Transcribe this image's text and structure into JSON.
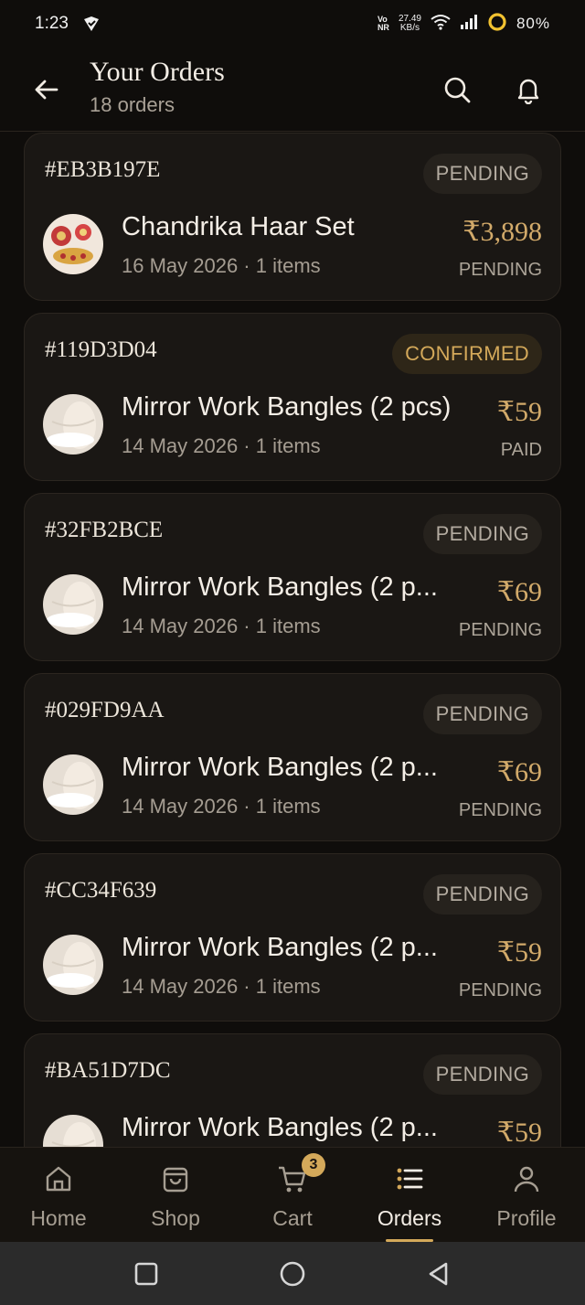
{
  "status_bar": {
    "time": "1:23",
    "network_top": "Vo",
    "network_bottom": "NR",
    "speed_value": "27.49",
    "speed_unit": "KB/s",
    "battery": "80%"
  },
  "header": {
    "title": "Your Orders",
    "subtitle": "18 orders",
    "back_icon": "arrow-left-icon",
    "search_icon": "search-icon",
    "bell_icon": "bell-icon"
  },
  "orders": [
    {
      "id": "#EB3B197E",
      "status": "PENDING",
      "product": "Chandrika Haar Set",
      "meta": "16 May 2026 · 1 items",
      "price": "₹3,898",
      "payment": "PENDING",
      "thumb": "jewelry"
    },
    {
      "id": "#119D3D04",
      "status": "CONFIRMED",
      "product": "Mirror Work Bangles (2 pcs)",
      "meta": "14 May 2026 · 1 items",
      "price": "₹59",
      "payment": "PAID",
      "thumb": "bangles"
    },
    {
      "id": "#32FB2BCE",
      "status": "PENDING",
      "product": "Mirror Work Bangles (2 p...",
      "meta": "14 May 2026 · 1 items",
      "price": "₹69",
      "payment": "PENDING",
      "thumb": "bangles"
    },
    {
      "id": "#029FD9AA",
      "status": "PENDING",
      "product": "Mirror Work Bangles (2 p...",
      "meta": "14 May 2026 · 1 items",
      "price": "₹69",
      "payment": "PENDING",
      "thumb": "bangles"
    },
    {
      "id": "#CC34F639",
      "status": "PENDING",
      "product": "Mirror Work Bangles (2 p...",
      "meta": "14 May 2026 · 1 items",
      "price": "₹59",
      "payment": "PENDING",
      "thumb": "bangles"
    },
    {
      "id": "#BA51D7DC",
      "status": "PENDING",
      "product": "Mirror Work Bangles (2 p...",
      "meta": "",
      "price": "₹59",
      "payment": "",
      "thumb": "bangles"
    }
  ],
  "bottom_nav": [
    {
      "label": "Home",
      "icon": "home-icon",
      "active": false
    },
    {
      "label": "Shop",
      "icon": "shopping-bag-icon",
      "active": false
    },
    {
      "label": "Cart",
      "icon": "cart-icon",
      "active": false,
      "badge": "3"
    },
    {
      "label": "Orders",
      "icon": "list-icon",
      "active": true
    },
    {
      "label": "Profile",
      "icon": "user-icon",
      "active": false
    }
  ],
  "colors": {
    "accent": "#d4a95a",
    "background": "#0f0d0b",
    "card": "#1a1714"
  }
}
